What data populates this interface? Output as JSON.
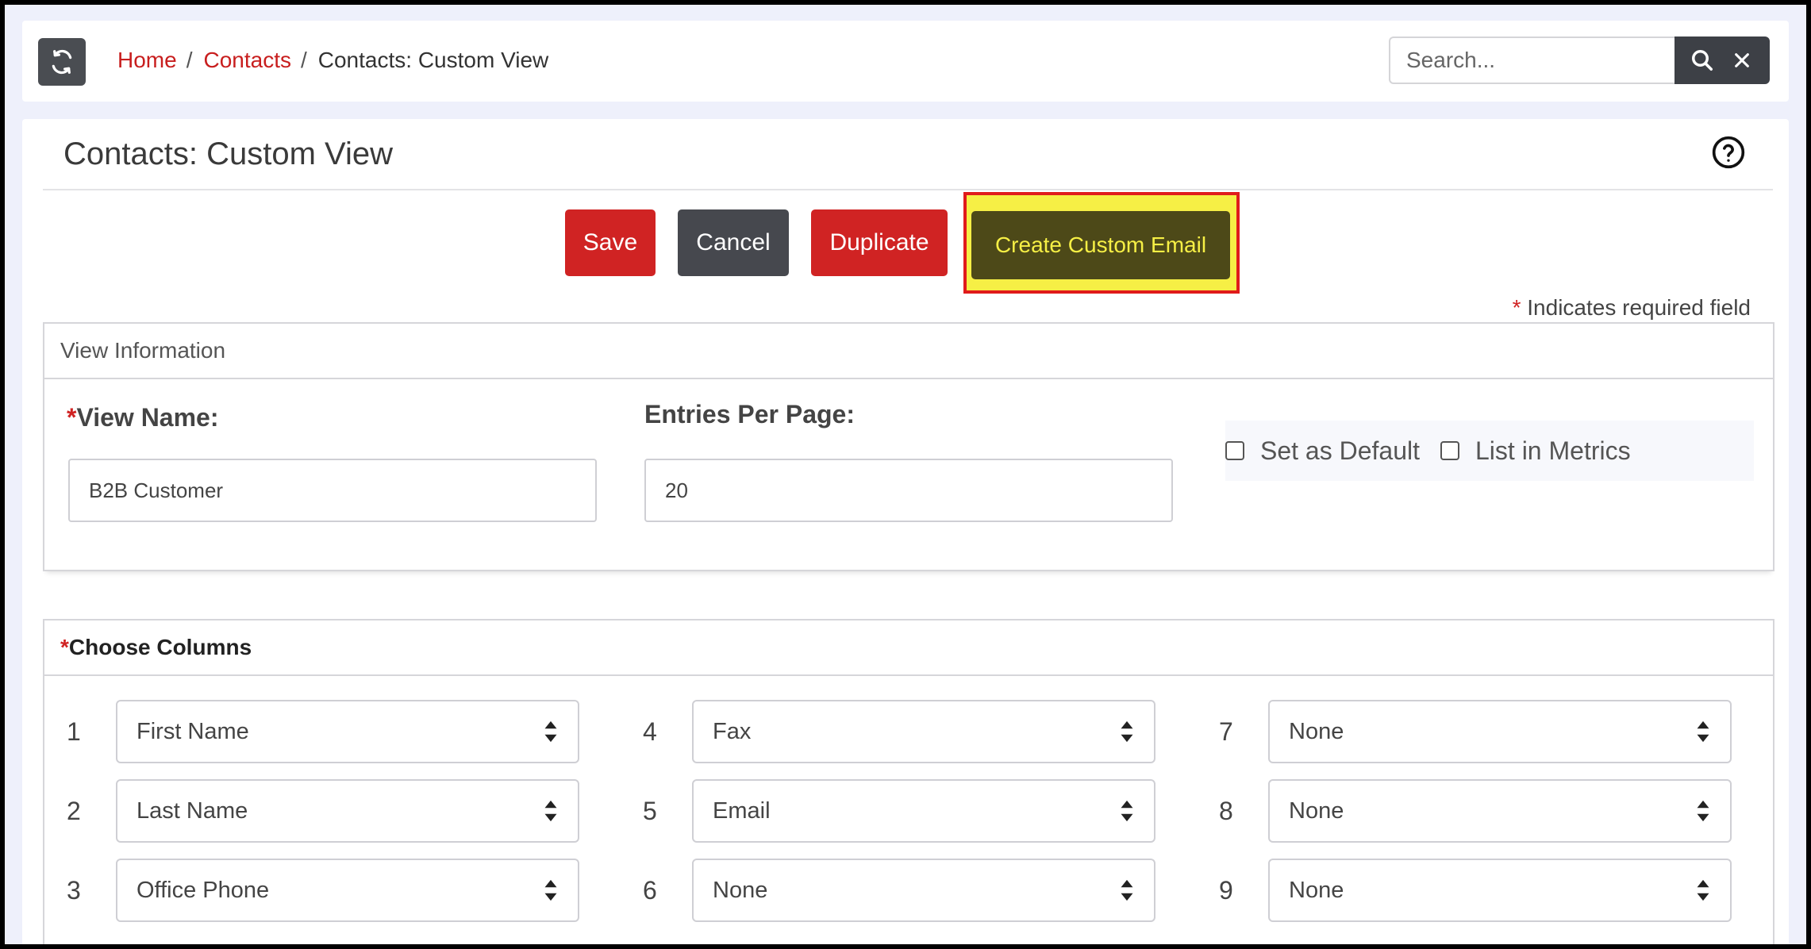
{
  "breadcrumb": {
    "home": "Home",
    "contacts": "Contacts",
    "current": "Contacts: Custom View",
    "separator": "/"
  },
  "search": {
    "placeholder": "Search..."
  },
  "icons": {
    "refresh": "refresh-icon",
    "search": "search-icon",
    "clear": "close-icon",
    "help": "help-circle-icon",
    "select": "updown-arrows-icon"
  },
  "page": {
    "title": "Contacts: Custom View"
  },
  "actions": {
    "save": "Save",
    "cancel": "Cancel",
    "duplicate": "Duplicate",
    "create_custom_email": "Create Custom Email"
  },
  "required_note": {
    "star": "*",
    "text": "Indicates required field"
  },
  "view_info": {
    "heading": "View Information",
    "view_name_label": "View Name:",
    "view_name_value": "B2B Customer",
    "entries_label": "Entries Per Page:",
    "entries_value": "20",
    "set_default_label": "Set as Default",
    "list_metrics_label": "List in Metrics"
  },
  "columns": {
    "heading": "Choose Columns",
    "items": [
      {
        "num": "1",
        "value": "First Name"
      },
      {
        "num": "2",
        "value": "Last Name"
      },
      {
        "num": "3",
        "value": "Office Phone"
      },
      {
        "num": "4",
        "value": "Fax"
      },
      {
        "num": "5",
        "value": "Email"
      },
      {
        "num": "6",
        "value": "None"
      },
      {
        "num": "7",
        "value": "None"
      },
      {
        "num": "8",
        "value": "None"
      },
      {
        "num": "9",
        "value": "None"
      }
    ]
  },
  "colors": {
    "brand_red": "#d02323",
    "dark_button": "#46484e",
    "highlight_yellow": "#f6ef45",
    "highlight_border": "#e01b1b"
  }
}
